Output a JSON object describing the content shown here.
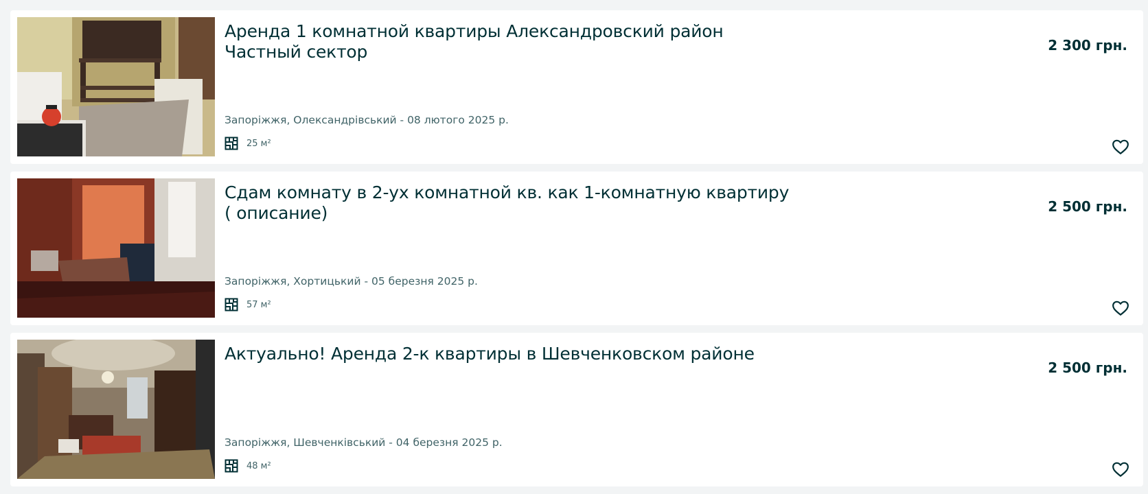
{
  "listings": [
    {
      "title": "Аренда 1 комнатной квартиры Александровский район Частный сектор",
      "price": "2 300 грн.",
      "location_date": "Запоріжжя, Олександрівський - 08 лютого 2025 р.",
      "area": "25 м²",
      "photo_icon": "kitchen-photo"
    },
    {
      "title": "Сдам комнату в 2-ух комнатной кв. как 1-комнатную квартиру ( описание)",
      "price": "2 500 грн.",
      "location_date": "Запоріжжя, Хортицький - 05 березня 2025 р.",
      "area": "57 м²",
      "photo_icon": "bedroom-photo"
    },
    {
      "title": "Актуально! Аренда 2-к квартиры в Шевченковском районе",
      "price": "2 500 грн.",
      "location_date": "Запоріжжя, Шевченківський - 04 березня 2025 р.",
      "area": "48 м²",
      "photo_icon": "living-room-photo"
    }
  ],
  "colors": {
    "text": "#002f34",
    "muted": "#406367",
    "background": "#f2f4f5",
    "card": "#ffffff"
  }
}
